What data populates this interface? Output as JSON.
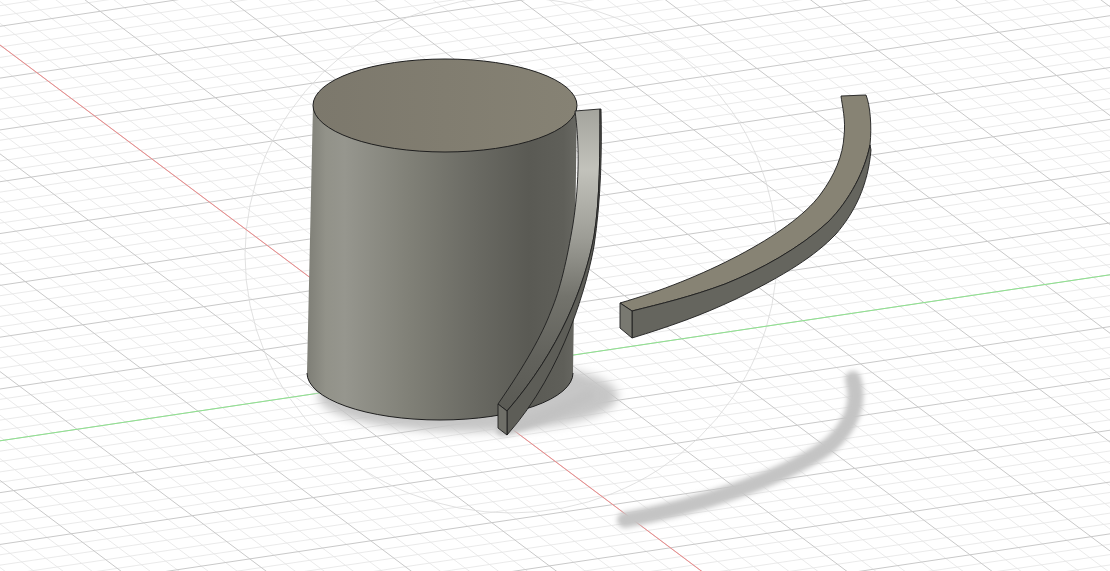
{
  "viewport": {
    "axes": [
      {
        "color": "#ef8a8a"
      },
      {
        "color": "#8ee48e"
      }
    ],
    "bodies": [
      {
        "kind": "cylinder"
      },
      {
        "kind": "sweep"
      },
      {
        "kind": "sweep"
      }
    ]
  }
}
